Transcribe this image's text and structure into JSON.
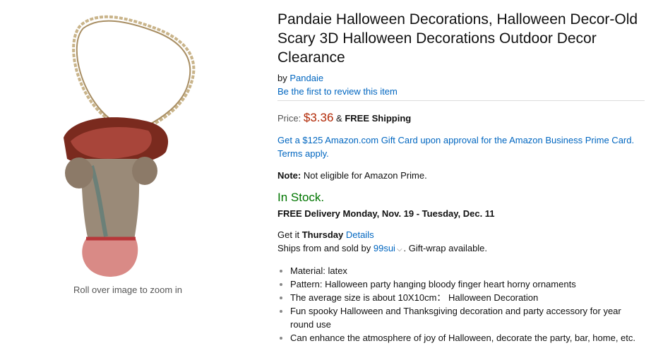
{
  "image": {
    "zoom_hint": "Roll over image to zoom in"
  },
  "product": {
    "title": "Pandaie Halloween Decorations, Halloween Decor-Old Scary 3D Halloween Decorations Outdoor Decor Clearance",
    "by_label": "by",
    "brand": "Pandaie",
    "review_link": "Be the first to review this item",
    "price_label": "Price:",
    "price": "$3.36",
    "price_sep": "&",
    "shipping": "FREE Shipping",
    "gift_card_offer": "Get a $125 Amazon.com Gift Card upon approval for the Amazon Business Prime Card. Terms apply.",
    "note_label": "Note:",
    "note_text": "Not eligible for Amazon Prime.",
    "stock": "In Stock.",
    "delivery": "FREE Delivery Monday, Nov. 19 - Tuesday, Dec. 11",
    "getit_prefix": "Get it",
    "getit_day": "Thursday",
    "details_link": "Details",
    "ships_prefix": "Ships from and sold by",
    "seller": "99sui",
    "ships_suffix": ". Gift-wrap available.",
    "bullets": [
      "Material: latex",
      "Pattern: Halloween party hanging bloody finger heart horny ornaments",
      "The average size is about 10X10cm： Halloween Decoration",
      "Fun spooky Halloween and Thanksgiving decoration and party accessory for year round use",
      "Can enhance the atmosphere of joy of Halloween, decorate the party, bar, home, etc."
    ]
  },
  "colors": {
    "link": "#0066c0",
    "price": "#b12704",
    "in_stock": "#007600"
  }
}
